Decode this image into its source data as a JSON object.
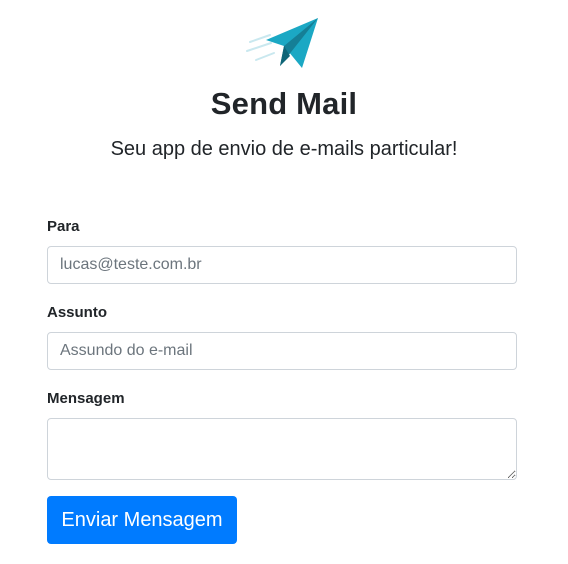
{
  "app": {
    "title": "Send Mail",
    "subtitle": "Seu app de envio de e-mails particular!",
    "logo_icon": "paper-plane-icon",
    "accent_color": "#1ba8c4"
  },
  "form": {
    "to": {
      "label": "Para",
      "placeholder": "lucas@teste.com.br",
      "value": ""
    },
    "subject": {
      "label": "Assunto",
      "placeholder": "Assundo do e-mail",
      "value": ""
    },
    "message": {
      "label": "Mensagem",
      "value": ""
    },
    "submit_label": "Enviar Mensagem",
    "submit_color": "#007bff"
  }
}
